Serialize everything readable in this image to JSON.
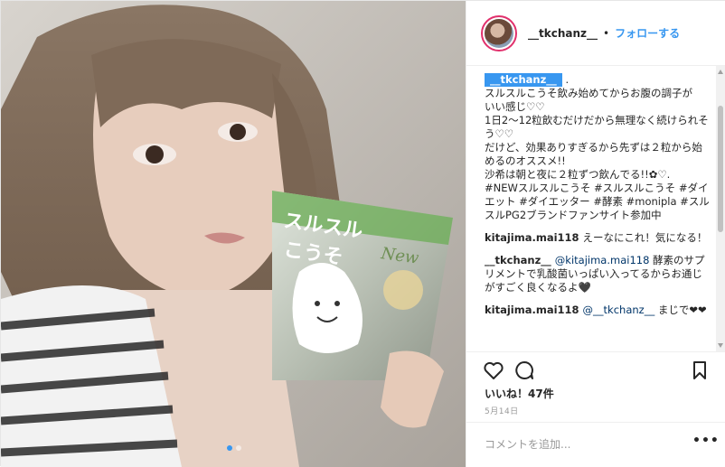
{
  "post": {
    "username": "__tkchanz__",
    "separator": "•",
    "follow_label": "フォローする"
  },
  "caption": {
    "user": "__tkchanz__",
    "tail": ".",
    "text": "スルスルこうそ飲み始めてからお腹の調子が\nいい感じ♡♡\n1日2〜12粒飲むだけだから無理なく続けられそう♡♡\nだけど、効果ありすぎるから先ずは２粒から始めるのオススメ!!\n沙希は朝と夜に２粒ずつ飲んでる!!✿♡.",
    "hashtags": "#NEWスルスルこうそ #スルスルこうそ #ダイエット #ダイエッター #酵素 #monipla #スルスルPG2ブランドファンサイト参加中"
  },
  "comments": [
    {
      "user": "kitajima.mai118",
      "text": "えーなにこれ！気になる！"
    },
    {
      "user": "__tkchanz__",
      "mention": "@kitajima.mai118",
      "text": " 酵素のサプリメントで乳酸菌いっぱい入ってるからお通じがすごく良くなるよ🖤"
    },
    {
      "user": "kitajima.mai118",
      "mention": "@__tkchanz__",
      "text": " まじで❤❤"
    }
  ],
  "likes": "いいね！47件",
  "date": "5月14日",
  "add_comment_placeholder": "コメントを追加...",
  "more_label": "•••",
  "product_label": {
    "line1": "スルスル",
    "line2": "こうそ",
    "brand": "New"
  },
  "carousel": {
    "count": 2,
    "active": 0
  },
  "colors": {
    "accent": "#3897f0",
    "text": "#262626",
    "muted": "#999999",
    "border": "#efefef"
  }
}
